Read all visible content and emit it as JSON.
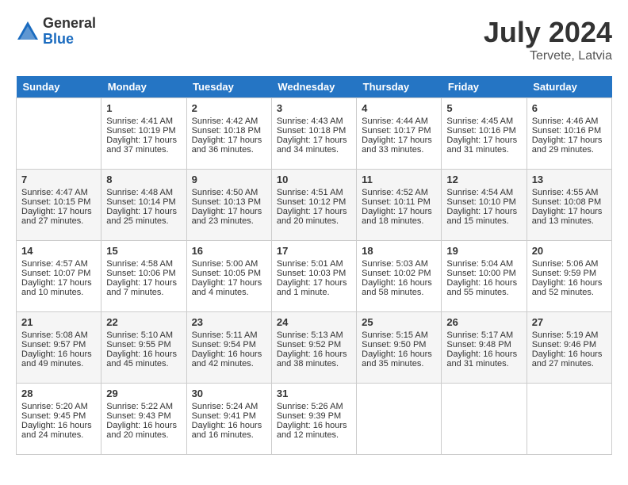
{
  "header": {
    "logo_general": "General",
    "logo_blue": "Blue",
    "month_year": "July 2024",
    "location": "Tervete, Latvia"
  },
  "columns": [
    "Sunday",
    "Monday",
    "Tuesday",
    "Wednesday",
    "Thursday",
    "Friday",
    "Saturday"
  ],
  "weeks": [
    [
      {
        "day": "",
        "content": ""
      },
      {
        "day": "1",
        "content": "Sunrise: 4:41 AM\nSunset: 10:19 PM\nDaylight: 17 hours\nand 37 minutes."
      },
      {
        "day": "2",
        "content": "Sunrise: 4:42 AM\nSunset: 10:18 PM\nDaylight: 17 hours\nand 36 minutes."
      },
      {
        "day": "3",
        "content": "Sunrise: 4:43 AM\nSunset: 10:18 PM\nDaylight: 17 hours\nand 34 minutes."
      },
      {
        "day": "4",
        "content": "Sunrise: 4:44 AM\nSunset: 10:17 PM\nDaylight: 17 hours\nand 33 minutes."
      },
      {
        "day": "5",
        "content": "Sunrise: 4:45 AM\nSunset: 10:16 PM\nDaylight: 17 hours\nand 31 minutes."
      },
      {
        "day": "6",
        "content": "Sunrise: 4:46 AM\nSunset: 10:16 PM\nDaylight: 17 hours\nand 29 minutes."
      }
    ],
    [
      {
        "day": "7",
        "content": "Sunrise: 4:47 AM\nSunset: 10:15 PM\nDaylight: 17 hours\nand 27 minutes."
      },
      {
        "day": "8",
        "content": "Sunrise: 4:48 AM\nSunset: 10:14 PM\nDaylight: 17 hours\nand 25 minutes."
      },
      {
        "day": "9",
        "content": "Sunrise: 4:50 AM\nSunset: 10:13 PM\nDaylight: 17 hours\nand 23 minutes."
      },
      {
        "day": "10",
        "content": "Sunrise: 4:51 AM\nSunset: 10:12 PM\nDaylight: 17 hours\nand 20 minutes."
      },
      {
        "day": "11",
        "content": "Sunrise: 4:52 AM\nSunset: 10:11 PM\nDaylight: 17 hours\nand 18 minutes."
      },
      {
        "day": "12",
        "content": "Sunrise: 4:54 AM\nSunset: 10:10 PM\nDaylight: 17 hours\nand 15 minutes."
      },
      {
        "day": "13",
        "content": "Sunrise: 4:55 AM\nSunset: 10:08 PM\nDaylight: 17 hours\nand 13 minutes."
      }
    ],
    [
      {
        "day": "14",
        "content": "Sunrise: 4:57 AM\nSunset: 10:07 PM\nDaylight: 17 hours\nand 10 minutes."
      },
      {
        "day": "15",
        "content": "Sunrise: 4:58 AM\nSunset: 10:06 PM\nDaylight: 17 hours\nand 7 minutes."
      },
      {
        "day": "16",
        "content": "Sunrise: 5:00 AM\nSunset: 10:05 PM\nDaylight: 17 hours\nand 4 minutes."
      },
      {
        "day": "17",
        "content": "Sunrise: 5:01 AM\nSunset: 10:03 PM\nDaylight: 17 hours\nand 1 minute."
      },
      {
        "day": "18",
        "content": "Sunrise: 5:03 AM\nSunset: 10:02 PM\nDaylight: 16 hours\nand 58 minutes."
      },
      {
        "day": "19",
        "content": "Sunrise: 5:04 AM\nSunset: 10:00 PM\nDaylight: 16 hours\nand 55 minutes."
      },
      {
        "day": "20",
        "content": "Sunrise: 5:06 AM\nSunset: 9:59 PM\nDaylight: 16 hours\nand 52 minutes."
      }
    ],
    [
      {
        "day": "21",
        "content": "Sunrise: 5:08 AM\nSunset: 9:57 PM\nDaylight: 16 hours\nand 49 minutes."
      },
      {
        "day": "22",
        "content": "Sunrise: 5:10 AM\nSunset: 9:55 PM\nDaylight: 16 hours\nand 45 minutes."
      },
      {
        "day": "23",
        "content": "Sunrise: 5:11 AM\nSunset: 9:54 PM\nDaylight: 16 hours\nand 42 minutes."
      },
      {
        "day": "24",
        "content": "Sunrise: 5:13 AM\nSunset: 9:52 PM\nDaylight: 16 hours\nand 38 minutes."
      },
      {
        "day": "25",
        "content": "Sunrise: 5:15 AM\nSunset: 9:50 PM\nDaylight: 16 hours\nand 35 minutes."
      },
      {
        "day": "26",
        "content": "Sunrise: 5:17 AM\nSunset: 9:48 PM\nDaylight: 16 hours\nand 31 minutes."
      },
      {
        "day": "27",
        "content": "Sunrise: 5:19 AM\nSunset: 9:46 PM\nDaylight: 16 hours\nand 27 minutes."
      }
    ],
    [
      {
        "day": "28",
        "content": "Sunrise: 5:20 AM\nSunset: 9:45 PM\nDaylight: 16 hours\nand 24 minutes."
      },
      {
        "day": "29",
        "content": "Sunrise: 5:22 AM\nSunset: 9:43 PM\nDaylight: 16 hours\nand 20 minutes."
      },
      {
        "day": "30",
        "content": "Sunrise: 5:24 AM\nSunset: 9:41 PM\nDaylight: 16 hours\nand 16 minutes."
      },
      {
        "day": "31",
        "content": "Sunrise: 5:26 AM\nSunset: 9:39 PM\nDaylight: 16 hours\nand 12 minutes."
      },
      {
        "day": "",
        "content": ""
      },
      {
        "day": "",
        "content": ""
      },
      {
        "day": "",
        "content": ""
      }
    ]
  ]
}
